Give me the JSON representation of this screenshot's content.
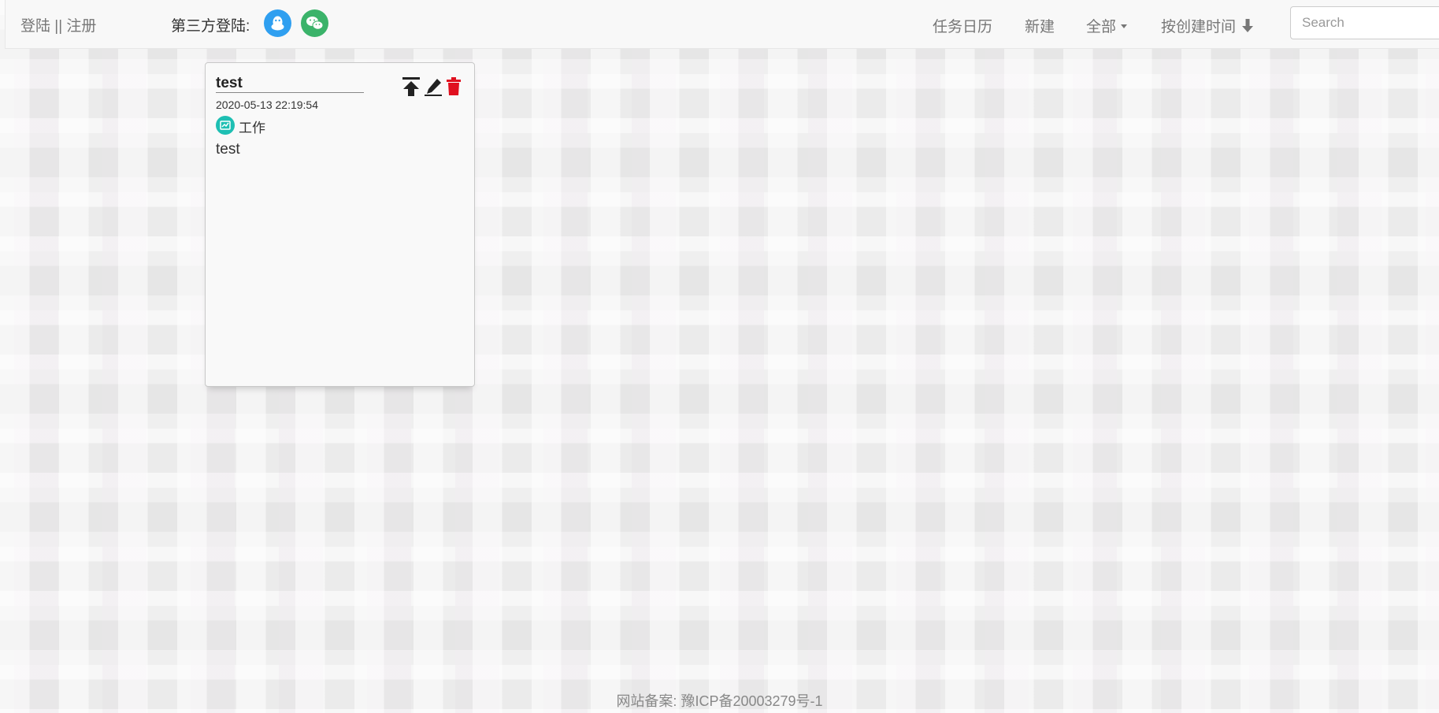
{
  "navbar": {
    "brand": "登陆 || 注册",
    "third_party_label": "第三方登陆:",
    "qq_icon": "qq-icon",
    "wechat_icon": "wechat-icon",
    "items": {
      "calendar": "任务日历",
      "new": "新建",
      "all": "全部",
      "sort": "按创建时间"
    },
    "search": {
      "placeholder": "Search",
      "value": ""
    },
    "colors": {
      "qq": "#2f9ff0",
      "wechat": "#3bb36a"
    }
  },
  "cards": [
    {
      "title": "test",
      "time": "2020-05-13 22:19:54",
      "category": "工作",
      "category_icon": "chart-icon",
      "category_color": "#1ebfb3",
      "body": "test",
      "actions": [
        "pin-top-icon",
        "edit-icon",
        "delete-icon"
      ],
      "delete_color": "#e0101f"
    }
  ],
  "footer": {
    "text": "网站备案: 豫ICP备20003279号-1"
  }
}
